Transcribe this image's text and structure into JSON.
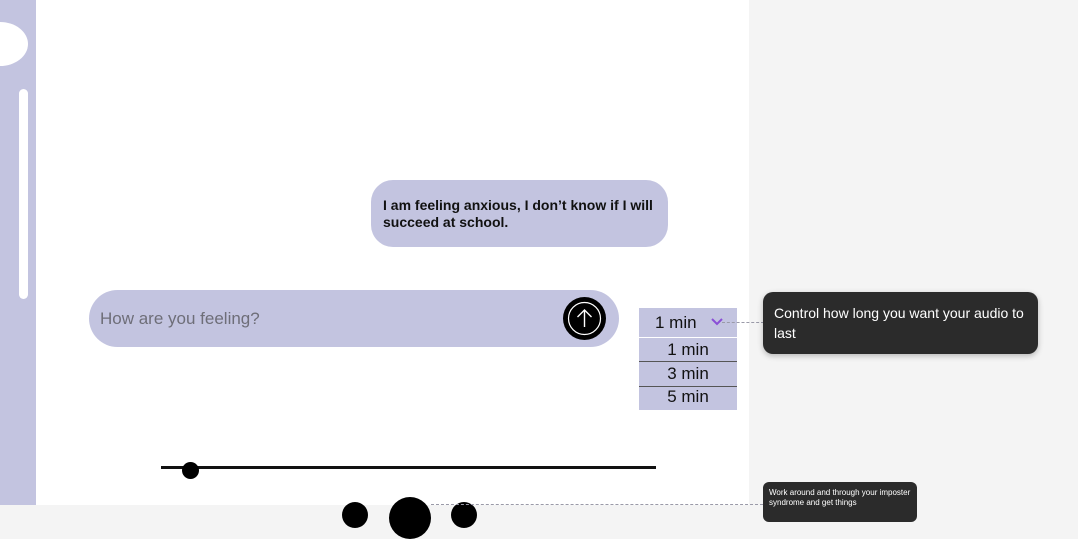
{
  "chat": {
    "user_message": "I am feeling anxious, I don’t know if I will succeed at school."
  },
  "input": {
    "placeholder": "How are you feeling?",
    "value": ""
  },
  "duration_dropdown": {
    "selected": "1 min",
    "options": [
      "1 min",
      "3 min",
      "5 min"
    ]
  },
  "annotations": {
    "duration_tooltip": "Control how long you want your audio to last",
    "playback_tooltip": "Work around and through your imposter syndrome and get things"
  },
  "audio": {
    "progress": 0.06
  },
  "colors": {
    "accent": "#c3c4e0",
    "tooltip_bg": "#2b2b2b",
    "dropdown_arrow": "#8a4fd6"
  },
  "icons": {
    "send": "arrow-up-icon",
    "dropdown": "chevron-down-icon"
  }
}
